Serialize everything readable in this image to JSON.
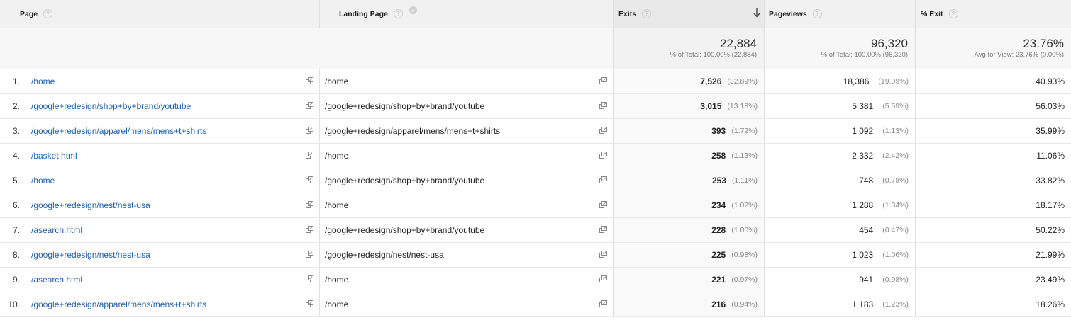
{
  "headers": {
    "page": "Page",
    "landing_page": "Landing Page",
    "exits": "Exits",
    "pageviews": "Pageviews",
    "pct_exit": "% Exit"
  },
  "totals": {
    "exits": "22,884",
    "exits_sub": "% of Total: 100.00% (22,884)",
    "pageviews": "96,320",
    "pageviews_sub": "% of Total: 100.00% (96,320)",
    "pct_exit": "23.76%",
    "pct_exit_sub": "Avg for View: 23.76% (0.00%)"
  },
  "rows": [
    {
      "idx": "1.",
      "page": "/home",
      "landing": "/home",
      "exits": "7,526",
      "exits_pct": "(32.89%)",
      "pv": "18,386",
      "pv_pct": "(19.09%)",
      "exit_rate": "40.93%"
    },
    {
      "idx": "2.",
      "page": "/google+redesign/shop+by+brand/youtube",
      "landing": "/google+redesign/shop+by+brand/youtube",
      "exits": "3,015",
      "exits_pct": "(13.18%)",
      "pv": "5,381",
      "pv_pct": "(5.59%)",
      "exit_rate": "56.03%"
    },
    {
      "idx": "3.",
      "page": "/google+redesign/apparel/mens/mens+t+shirts",
      "landing": "/google+redesign/apparel/mens/mens+t+shirts",
      "exits": "393",
      "exits_pct": "(1.72%)",
      "pv": "1,092",
      "pv_pct": "(1.13%)",
      "exit_rate": "35.99%"
    },
    {
      "idx": "4.",
      "page": "/basket.html",
      "landing": "/home",
      "exits": "258",
      "exits_pct": "(1.13%)",
      "pv": "2,332",
      "pv_pct": "(2.42%)",
      "exit_rate": "11.06%"
    },
    {
      "idx": "5.",
      "page": "/home",
      "landing": "/google+redesign/shop+by+brand/youtube",
      "exits": "253",
      "exits_pct": "(1.11%)",
      "pv": "748",
      "pv_pct": "(0.78%)",
      "exit_rate": "33.82%"
    },
    {
      "idx": "6.",
      "page": "/google+redesign/nest/nest-usa",
      "landing": "/home",
      "exits": "234",
      "exits_pct": "(1.02%)",
      "pv": "1,288",
      "pv_pct": "(1.34%)",
      "exit_rate": "18.17%"
    },
    {
      "idx": "7.",
      "page": "/asearch.html",
      "landing": "/google+redesign/shop+by+brand/youtube",
      "exits": "228",
      "exits_pct": "(1.00%)",
      "pv": "454",
      "pv_pct": "(0.47%)",
      "exit_rate": "50.22%"
    },
    {
      "idx": "8.",
      "page": "/google+redesign/nest/nest-usa",
      "landing": "/google+redesign/nest/nest-usa",
      "exits": "225",
      "exits_pct": "(0.98%)",
      "pv": "1,023",
      "pv_pct": "(1.06%)",
      "exit_rate": "21.99%"
    },
    {
      "idx": "9.",
      "page": "/asearch.html",
      "landing": "/home",
      "exits": "221",
      "exits_pct": "(0.97%)",
      "pv": "941",
      "pv_pct": "(0.98%)",
      "exit_rate": "23.49%"
    },
    {
      "idx": "10.",
      "page": "/google+redesign/apparel/mens/mens+t+shirts",
      "landing": "/home",
      "exits": "216",
      "exits_pct": "(0.94%)",
      "pv": "1,183",
      "pv_pct": "(1.23%)",
      "exit_rate": "18.26%"
    }
  ],
  "icons": {
    "help": "question-mark-icon",
    "remove": "close-icon",
    "sort": "arrow-down-icon",
    "open": "external-link-icon"
  },
  "colors": {
    "link": "#1f5fa8",
    "header_bg": "#f1f1f1"
  }
}
